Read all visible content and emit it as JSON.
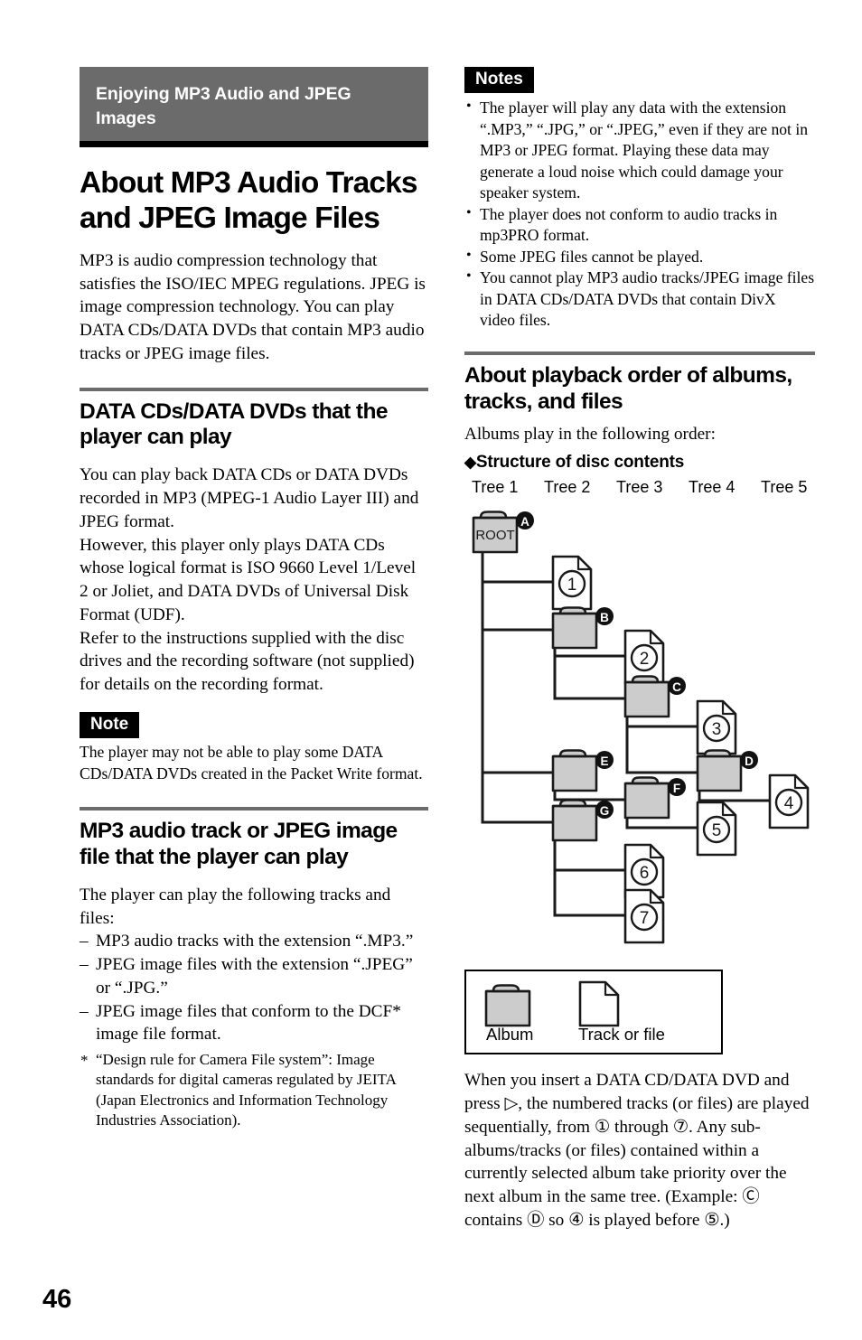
{
  "page": {
    "number": "46",
    "chapter_banner": "Enjoying MP3 Audio and JPEG Images",
    "title": "About MP3 Audio Tracks and JPEG Image Files",
    "intro": "MP3 is audio compression technology that satisfies the ISO/IEC MPEG regulations. JPEG is image compression technology. You can play DATA CDs/DATA DVDs that contain MP3 audio tracks or JPEG image files."
  },
  "section_data_cds": {
    "heading": "DATA CDs/DATA DVDs that the player can play",
    "paragraphs": [
      "You can play back DATA CDs or DATA DVDs recorded in MP3 (MPEG-1 Audio Layer III) and JPEG format.",
      "However, this player only plays DATA CDs whose logical format is ISO 9660 Level 1/Level 2 or Joliet, and DATA DVDs of Universal Disk Format (UDF).",
      "Refer to the instructions supplied with the disc drives and the recording software (not supplied) for details on the recording format."
    ],
    "note_tag": "Note",
    "note_text": "The player may not be able to play some DATA CDs/DATA DVDs created in the Packet Write format."
  },
  "section_mp3_files": {
    "heading": "MP3 audio track or JPEG image file that the player can play",
    "intro": "The player can play the following tracks and files:",
    "items": [
      "MP3 audio tracks with the extension “.MP3.”",
      "JPEG image files with the extension “.JPEG” or “.JPG.”",
      "JPEG image files that conform to the DCF* image file format."
    ],
    "footnote": "“Design rule for Camera File system”: Image standards for digital cameras regulated by JEITA (Japan Electronics and Information Technology Industries Association)."
  },
  "notes_block": {
    "tag": "Notes",
    "items": [
      "The player will play any data with the extension “.MP3,” “.JPG,” or “.JPEG,” even if they are not in MP3 or JPEG format. Playing these data may generate a loud noise which could damage your speaker system.",
      "The player does not conform to audio tracks in mp3PRO format.",
      "Some JPEG files cannot be played.",
      "You cannot play MP3 audio tracks/JPEG image files in DATA CDs/DATA DVDs that contain DivX video files."
    ]
  },
  "section_playback_order": {
    "heading": "About playback order of albums, tracks, and files",
    "intro": "Albums play in the following order:",
    "sub_heading": "Structure of disc contents",
    "sub_heading_marker": "◆",
    "closing_paragraph": "When you insert a DATA CD/DATA DVD and press ▷, the numbered tracks (or files) are played sequentially, from ① through ⑦. Any sub-albums/tracks (or files) contained within a currently selected album take priority over the next album in the same tree. (Example: Ⓒ contains Ⓓ so ④ is played before ⑤.)"
  },
  "tree_diagram": {
    "column_labels": [
      "Tree 1",
      "Tree 2",
      "Tree 3",
      "Tree 4",
      "Tree 5"
    ],
    "root_label": "ROOT",
    "folders": [
      {
        "id": "A",
        "label": "ROOT",
        "tree": 1
      },
      {
        "id": "B",
        "label": "",
        "tree": 2
      },
      {
        "id": "C",
        "label": "",
        "tree": 3
      },
      {
        "id": "D",
        "label": "",
        "tree": 4
      },
      {
        "id": "E",
        "label": "",
        "tree": 2
      },
      {
        "id": "F",
        "label": "",
        "tree": 3
      },
      {
        "id": "G",
        "label": "",
        "tree": 2
      }
    ],
    "files": [
      {
        "id": "1",
        "tree": 2,
        "parent": "A"
      },
      {
        "id": "2",
        "tree": 3,
        "parent": "B"
      },
      {
        "id": "3",
        "tree": 4,
        "parent": "C"
      },
      {
        "id": "4",
        "tree": 5,
        "parent": "D"
      },
      {
        "id": "5",
        "tree": 4,
        "parent": "F"
      },
      {
        "id": "6",
        "tree": 3,
        "parent": "G"
      },
      {
        "id": "7",
        "tree": 3,
        "parent": "G"
      }
    ],
    "legend": {
      "album": "Album",
      "file": "Track or file"
    }
  },
  "colors": {
    "banner_gray": "#6b6b6b",
    "rule_gray": "#6b6b6b",
    "tag_black": "#000000",
    "folder_fill": "#cccccc"
  }
}
